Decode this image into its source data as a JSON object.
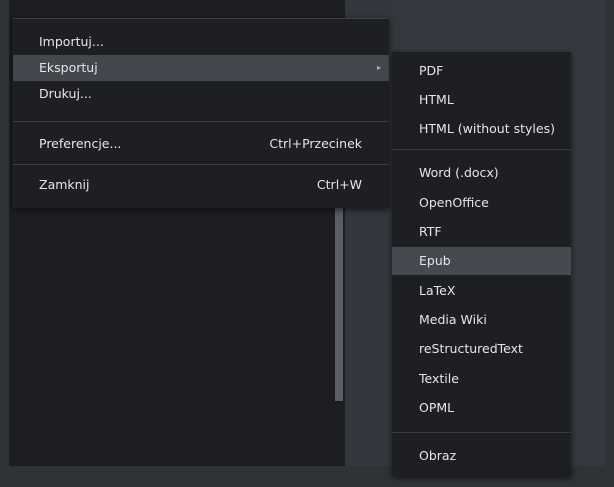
{
  "main_menu": {
    "items": [
      {
        "label": "Importuj...",
        "shortcut": ""
      },
      {
        "label": "Eksportuj",
        "shortcut": "",
        "submenu_arrow": "▸"
      },
      {
        "label": "Drukuj...",
        "shortcut": ""
      },
      {
        "label": "Preferencje...",
        "shortcut": "Ctrl+Przecinek"
      },
      {
        "label": "Zamknij",
        "shortcut": "Ctrl+W"
      }
    ],
    "highlighted": "Eksportuj"
  },
  "export_submenu": {
    "items": [
      {
        "label": "PDF"
      },
      {
        "label": "HTML"
      },
      {
        "label": "HTML (without styles)"
      },
      {
        "label": "Word (.docx)"
      },
      {
        "label": "OpenOffice"
      },
      {
        "label": "RTF"
      },
      {
        "label": "Epub"
      },
      {
        "label": "LaTeX"
      },
      {
        "label": "Media Wiki"
      },
      {
        "label": "reStructuredText"
      },
      {
        "label": "Textile"
      },
      {
        "label": "OPML"
      },
      {
        "label": "Obraz"
      }
    ],
    "highlighted": "Epub"
  },
  "colors": {
    "menu_bg": "#1e1f23",
    "highlight_bg": "#44474d",
    "text": "#e6e6e6"
  }
}
